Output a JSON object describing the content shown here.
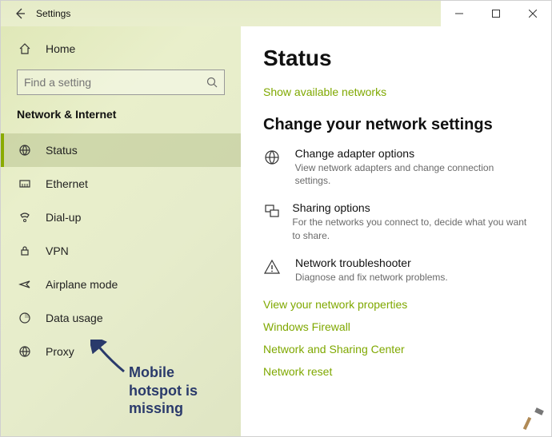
{
  "window": {
    "title": "Settings"
  },
  "sidebar": {
    "home_label": "Home",
    "search_placeholder": "Find a setting",
    "category": "Network & Internet",
    "items": [
      {
        "label": "Status"
      },
      {
        "label": "Ethernet"
      },
      {
        "label": "Dial-up"
      },
      {
        "label": "VPN"
      },
      {
        "label": "Airplane mode"
      },
      {
        "label": "Data usage"
      },
      {
        "label": "Proxy"
      }
    ]
  },
  "main": {
    "heading": "Status",
    "show_networks": "Show available networks",
    "subheading": "Change your network settings",
    "options": [
      {
        "title": "Change adapter options",
        "desc": "View network adapters and change connection settings."
      },
      {
        "title": "Sharing options",
        "desc": "For the networks you connect to, decide what you want to share."
      },
      {
        "title": "Network troubleshooter",
        "desc": "Diagnose and fix network problems."
      }
    ],
    "links": [
      "View your network properties",
      "Windows Firewall",
      "Network and Sharing Center",
      "Network reset"
    ]
  },
  "annotation": {
    "line1": "Mobile",
    "line2": "hotspot is",
    "line3": "missing"
  }
}
